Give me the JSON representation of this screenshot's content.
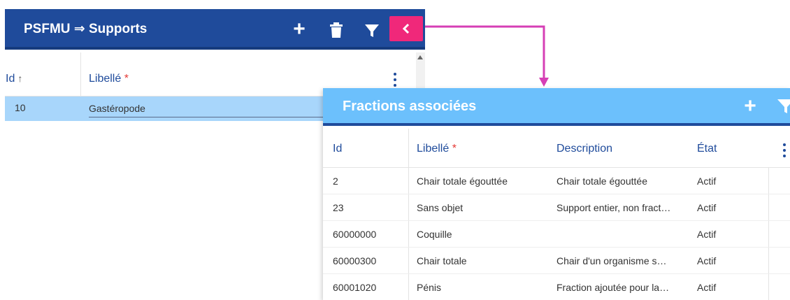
{
  "supports_panel": {
    "title": "PSFMU ⇒ Supports",
    "toolbar_icons": [
      "add-icon",
      "trash-icon",
      "filter-icon",
      "chevron-left-icon"
    ],
    "columns": {
      "id": "Id",
      "id_sort_arrow": "↑",
      "libelle": "Libellé",
      "required_mark": "*"
    },
    "rows": [
      {
        "id": "10",
        "libelle": "Gastéropode"
      }
    ]
  },
  "fractions_panel": {
    "title": "Fractions associées",
    "toolbar_icons": [
      "add-icon",
      "filter-icon"
    ],
    "columns": {
      "id": "Id",
      "libelle": "Libellé",
      "required_mark": "*",
      "description": "Description",
      "etat": "État"
    },
    "rows": [
      {
        "id": "2",
        "libelle": "Chair totale égouttée",
        "description": "Chair totale égouttée",
        "etat": "Actif"
      },
      {
        "id": "23",
        "libelle": "Sans objet",
        "description": "Support entier, non fract…",
        "etat": "Actif"
      },
      {
        "id": "60000000",
        "libelle": "Coquille",
        "description": "",
        "etat": "Actif"
      },
      {
        "id": "60000300",
        "libelle": "Chair totale",
        "description": "Chair d'un organisme s…",
        "etat": "Actif"
      },
      {
        "id": "60001020",
        "libelle": "Pénis",
        "description": "Fraction ajoutée pour la…",
        "etat": "Actif"
      }
    ]
  },
  "colors": {
    "primary_toolbar": "#1f4b9b",
    "secondary_toolbar": "#6cc0fc",
    "accent_pink": "#f0287a",
    "selected_row": "#a8d6fb",
    "required_mark": "#e53935",
    "connector": "#d63fb5"
  }
}
